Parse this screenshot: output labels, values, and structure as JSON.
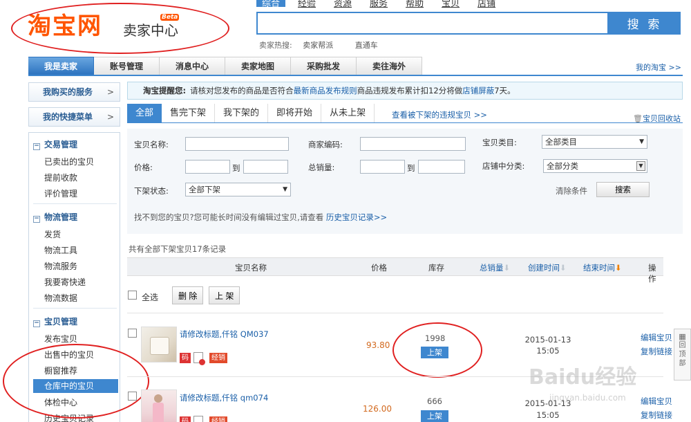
{
  "header": {
    "logo_main": "淘宝网",
    "logo_sub": "卖家中心",
    "logo_badge": "Beta",
    "search_tabs": [
      "综合",
      "经验",
      "资源",
      "服务",
      "帮助",
      "宝贝",
      "店铺"
    ],
    "search_button": "搜 索",
    "hot_label": "卖家热搜:",
    "hot_links": [
      "卖家帮派",
      "直通车"
    ]
  },
  "nav": {
    "items": [
      "我是卖家",
      "账号管理",
      "消息中心",
      "卖家地图",
      "采购批发",
      "卖往海外"
    ],
    "right_link": "我的淘宝 >>"
  },
  "sidebar": {
    "top_buttons": [
      {
        "label": "我购买的服务",
        "arrow": ">"
      },
      {
        "label": "我的快捷菜单",
        "arrow": ">"
      }
    ],
    "groups": [
      {
        "title": "交易管理",
        "toggle": "−",
        "items": [
          "已卖出的宝贝",
          "提前收款",
          "评价管理"
        ]
      },
      {
        "title": "物流管理",
        "toggle": "−",
        "items": [
          "发货",
          "物流工具",
          "物流服务",
          "我要寄快递",
          "物流数据"
        ]
      },
      {
        "title": "宝贝管理",
        "toggle": "−",
        "items": [
          "发布宝贝",
          "出售中的宝贝",
          "橱窗推荐",
          "仓库中的宝贝",
          "体检中心",
          "历史宝贝记录"
        ]
      }
    ]
  },
  "notice": {
    "label": "淘宝提醒您:",
    "pre": "请核对您发布的商品是否符合",
    "link1": "最新商品发布规则",
    "mid": "商品违规发布累计扣12分将做",
    "link2": "店铺屏蔽",
    "post": "7天。"
  },
  "tabs": {
    "items": [
      "全部",
      "售完下架",
      "我下架的",
      "即将开始",
      "从未上架"
    ],
    "link": "查看被下架的违规宝贝 >>",
    "recycle": "宝贝回收站"
  },
  "filter": {
    "name_label": "宝贝名称:",
    "code_label": "商家编码:",
    "category_label": "宝贝类目:",
    "category_value": "全部类目",
    "price_label": "价格:",
    "to": "到",
    "sales_label": "总销量:",
    "shop_cat_label": "店铺中分类:",
    "shop_cat_value": "全部分类",
    "status_label": "下架状态:",
    "status_value": "全部下架",
    "clear": "清除条件",
    "search": "搜索",
    "note": "找不到您的宝贝?您可能长时间没有编辑过宝贝,请查看",
    "note_link": "历史宝贝记录>>"
  },
  "table": {
    "count": "共有全部下架宝贝17条记录",
    "headers": {
      "name": "宝贝名称",
      "price": "价格",
      "stock": "库存",
      "sales": "总销量",
      "created": "创建时间",
      "end": "结束时间",
      "op": "操作"
    },
    "select_all": "全选",
    "delete_btn": "删 除",
    "list_btn": "上 架",
    "rows": [
      {
        "title": "请修改标题,仟铭 QM037",
        "price": "93.80",
        "stock": "1998",
        "up": "上架",
        "date": "2015-01-13",
        "time": "15:05",
        "edit": "编辑宝贝",
        "copy": "复制链接",
        "tag_code": "码",
        "tag_sale": "经销"
      },
      {
        "title": "请修改标题,仟铭 qm074",
        "price": "126.00",
        "stock": "666",
        "up": "上架",
        "date": "2015-01-13",
        "time": "15:05",
        "edit": "编辑宝贝",
        "copy": "复制链接",
        "tag_code": "码",
        "tag_sale": "经销"
      }
    ]
  },
  "float": {
    "label": "回顶部"
  },
  "watermark": {
    "main": "Baidu经验",
    "url": "jingyan.baidu.com"
  },
  "colors": {
    "accent": "#3e87cf",
    "brand": "#ff5500",
    "highlight": "#e02020"
  }
}
